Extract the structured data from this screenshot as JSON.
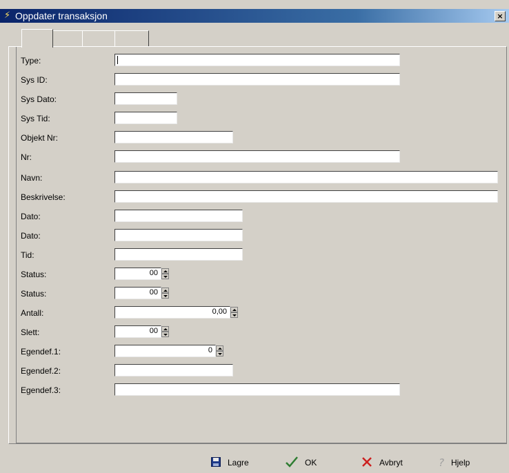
{
  "window": {
    "title": "Oppdater transaksjon",
    "close_glyph": "×"
  },
  "form": {
    "labels": [
      "Type:",
      "Sys ID:",
      "Sys Dato:",
      "Sys Tid:",
      "Objekt Nr:",
      "Nr:",
      "Navn:",
      "Beskrivelse:",
      "Dato:",
      "Dato:",
      "Tid:",
      "Status:",
      "Status:",
      "Antall:",
      "Slett:",
      "Egendef.1:",
      "Egendef.2:",
      "Egendef.3:"
    ],
    "values": {
      "status1": "00",
      "status2": "00",
      "antall": "0,00",
      "slett": "00",
      "egendef1": "0"
    }
  },
  "footer": {
    "save": "Lagre",
    "ok": "OK",
    "cancel": "Avbryt",
    "help": "Hjelp"
  },
  "icons": {
    "save": "floppy-disk-icon",
    "ok": "checkmark-icon",
    "cancel": "x-icon",
    "help": "question-icon"
  }
}
